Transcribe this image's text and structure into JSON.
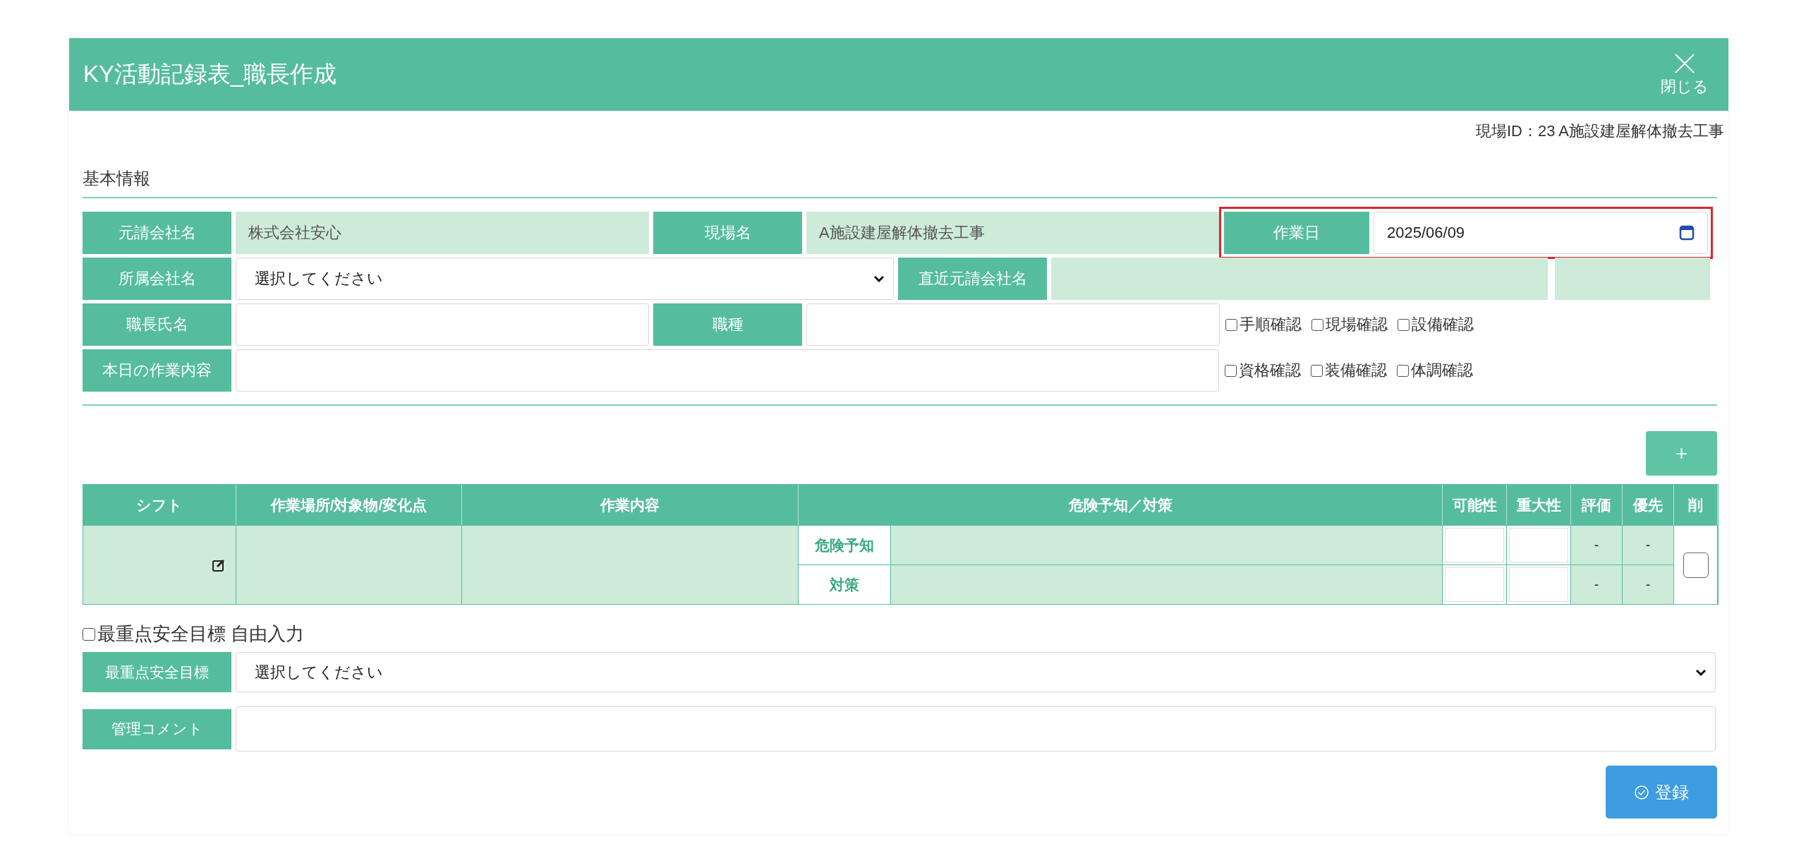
{
  "window": {
    "title": "KY活動記録表_職長作成",
    "close_label": "閉じる"
  },
  "site_id": "現場ID：23 A施設建屋解体撤去工事",
  "section_title": "基本情報",
  "basic_info": {
    "prime_contractor": {
      "label": "元請会社名",
      "value": "株式会社安心"
    },
    "site_name": {
      "label": "現場名",
      "value": "A施設建屋解体撤去工事"
    },
    "work_date": {
      "label": "作業日",
      "value": "2025/06/09",
      "highlighted": true
    },
    "affiliated_company": {
      "label": "所属会社名",
      "value": "選択してください"
    },
    "nearest_prime": {
      "label": "直近元請会社名"
    },
    "foreman_name": {
      "label": "職長氏名"
    },
    "trade": {
      "label": "職種"
    },
    "todays_work": {
      "label": "本日の作業内容"
    },
    "checks": [
      {
        "label": "手順確認",
        "checked": false
      },
      {
        "label": "現場確認",
        "checked": false
      },
      {
        "label": "設備確認",
        "checked": false
      },
      {
        "label": "資格確認",
        "checked": false
      },
      {
        "label": "装備確認",
        "checked": false
      },
      {
        "label": "体調確認",
        "checked": false
      }
    ]
  },
  "add_button": "+",
  "table": {
    "columns": [
      "シフト",
      "作業場所/対象物/変化点",
      "作業内容",
      "危険予知／対策",
      "可能性",
      "重大性",
      "評価",
      "優先",
      "削"
    ],
    "rows": [
      {
        "hazard_label": "危険予知",
        "measure_label": "対策",
        "evaluation": [
          "-",
          "-"
        ],
        "priority": [
          "-",
          "-"
        ],
        "delete_checked": false
      }
    ]
  },
  "free_input": {
    "label": "最重点安全目標 自由入力",
    "checked": false
  },
  "goal": {
    "label": "最重点安全目標",
    "value": "選択してください"
  },
  "comment": {
    "label": "管理コメント"
  },
  "submit_button": "登録"
}
